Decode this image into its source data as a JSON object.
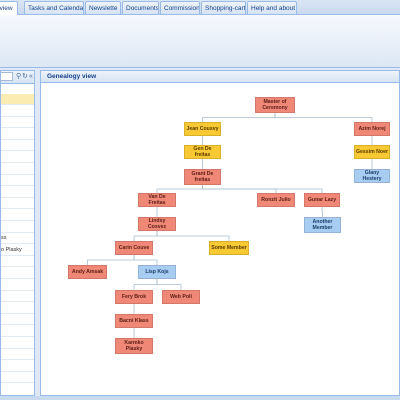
{
  "tabs": [
    {
      "label": "t view",
      "active": true
    },
    {
      "label": "Tasks and Calendar",
      "active": false
    },
    {
      "label": "Newslette",
      "active": false
    },
    {
      "label": "Documents",
      "active": false
    },
    {
      "label": "Commission",
      "active": false
    },
    {
      "label": "Shopping-cart",
      "active": false
    },
    {
      "label": "Help and about",
      "active": false
    }
  ],
  "sidebar": {
    "icons": [
      "search-icon",
      "refresh-icon",
      "collapse-icon"
    ],
    "icon_glyphs": [
      "⚲",
      "↻",
      "«"
    ],
    "rows": [
      "",
      "",
      "",
      "",
      "",
      "",
      "",
      "",
      "",
      "",
      "",
      "",
      "ss",
      "o Plasky",
      "",
      "",
      "",
      "",
      "",
      "",
      "",
      "",
      "",
      "",
      ""
    ]
  },
  "main": {
    "title": "Genealogy view"
  },
  "tree": {
    "colors": {
      "red": "#f08878",
      "yellow": "#f8c933",
      "blue": "#a8cdf2",
      "line": "#a9bccf"
    },
    "nodes": [
      {
        "id": "master",
        "label": "Master of Ceremony",
        "color": "red"
      },
      {
        "id": "jean",
        "label": "Jean Cousvy",
        "color": "yellow"
      },
      {
        "id": "azim",
        "label": "Azim Norej",
        "color": "red"
      },
      {
        "id": "gen",
        "label": "Gen De freitas",
        "color": "yellow"
      },
      {
        "id": "gessim",
        "label": "Gessim Noer",
        "color": "yellow"
      },
      {
        "id": "glany",
        "label": "Glany Hestery",
        "color": "blue"
      },
      {
        "id": "grant",
        "label": "Grant De freitas",
        "color": "red"
      },
      {
        "id": "van",
        "label": "Van De Freitas",
        "color": "red"
      },
      {
        "id": "ronzit",
        "label": "Ronzit Julio",
        "color": "red"
      },
      {
        "id": "gunar",
        "label": "Gunar Lazy",
        "color": "red"
      },
      {
        "id": "another",
        "label": "Another Member",
        "color": "blue"
      },
      {
        "id": "lindsy",
        "label": "Lindsy Cosvez",
        "color": "red"
      },
      {
        "id": "carin",
        "label": "Carin Couve",
        "color": "red"
      },
      {
        "id": "some",
        "label": "Some Member",
        "color": "yellow"
      },
      {
        "id": "andy",
        "label": "Andy Amsak",
        "color": "red"
      },
      {
        "id": "lisp",
        "label": "Lisp Kojs",
        "color": "blue"
      },
      {
        "id": "fery",
        "label": "Fery Brok",
        "color": "red"
      },
      {
        "id": "web",
        "label": "Web Poli",
        "color": "red"
      },
      {
        "id": "bacni",
        "label": "Bacni Klass",
        "color": "red"
      },
      {
        "id": "karmko",
        "label": "Karmko Plasky",
        "color": "red"
      }
    ]
  }
}
